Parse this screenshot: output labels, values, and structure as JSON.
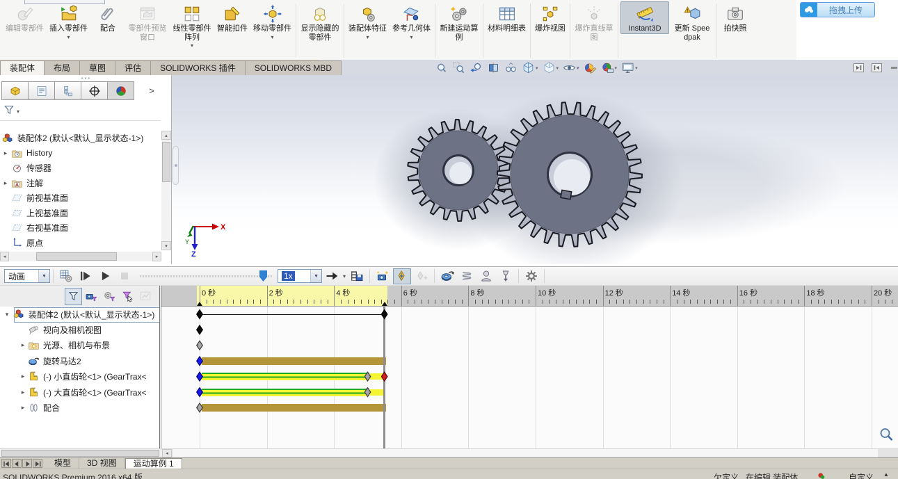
{
  "window": {
    "upload_button_label": "拖拽上传"
  },
  "ribbon": {
    "items": [
      {
        "label": "编辑零部件",
        "icon": "edit-component",
        "disabled": true
      },
      {
        "label": "插入零部件",
        "icon": "insert-component",
        "dropdown": true
      },
      {
        "label": "配合",
        "icon": "mate"
      },
      {
        "label": "零部件预览窗口",
        "icon": "component-preview",
        "disabled": true
      },
      {
        "label": "线性零部件阵列",
        "icon": "linear-pattern",
        "dropdown": true
      },
      {
        "label": "智能扣件",
        "icon": "smart-fasteners"
      },
      {
        "label": "移动零部件",
        "icon": "move-component",
        "dropdown": true
      },
      {
        "label": "显示隐藏的零部件",
        "icon": "show-hidden"
      },
      {
        "label": "装配体特征",
        "icon": "assembly-features",
        "dropdown": true
      },
      {
        "label": "参考几何体",
        "icon": "reference-geometry",
        "dropdown": true
      },
      {
        "label": "新建运动算例",
        "icon": "new-motion-study"
      },
      {
        "label": "材料明细表",
        "icon": "bom"
      },
      {
        "label": "爆炸视图",
        "icon": "exploded-view"
      },
      {
        "label": "爆炸直线草图",
        "icon": "explode-line-sketch",
        "disabled": true
      },
      {
        "label": "Instant3D",
        "icon": "instant3d",
        "active": true
      },
      {
        "label": "更新 Speedpak",
        "icon": "update-speedpak"
      },
      {
        "label": "拍快照",
        "icon": "take-snapshot"
      }
    ]
  },
  "command_tabs": {
    "items": [
      "装配体",
      "布局",
      "草图",
      "评估",
      "SOLIDWORKS 插件",
      "SOLIDWORKS MBD"
    ],
    "active_index": 0
  },
  "headsup_toolbar": {
    "icons": [
      {
        "name": "zoom-to-fit"
      },
      {
        "name": "zoom-to-area"
      },
      {
        "name": "previous-view"
      },
      {
        "name": "section-view"
      },
      {
        "name": "dynamic-annotation-views"
      },
      {
        "name": "view-orientation",
        "dropdown": true
      },
      {
        "name": "display-style",
        "dropdown": true
      },
      {
        "name": "hide-show-items",
        "dropdown": true
      },
      {
        "name": "edit-appearance"
      },
      {
        "name": "apply-scene",
        "dropdown": true
      },
      {
        "name": "view-settings",
        "dropdown": true
      }
    ]
  },
  "feature_panel": {
    "tabs": [
      "featuremanager-design-tree",
      "propertymanager",
      "configurationmanager",
      "dimxpertmanager",
      "displaymanager"
    ],
    "filter_icon": "filter-funnel",
    "root_label": "装配体2 (默认<默认_显示状态-1>)",
    "items": [
      {
        "label": "History",
        "icon": "history",
        "expandable": true
      },
      {
        "label": "传感器",
        "icon": "sensors"
      },
      {
        "label": "注解",
        "icon": "annotations",
        "expandable": true
      },
      {
        "label": "前视基准面",
        "icon": "plane"
      },
      {
        "label": "上视基准面",
        "icon": "plane"
      },
      {
        "label": "右视基准面",
        "icon": "plane"
      },
      {
        "label": "原点",
        "icon": "origin"
      }
    ]
  },
  "viewport": {
    "triad": {
      "x_label": "X",
      "y_label": "Y",
      "z_label": "Z"
    }
  },
  "motion_manager": {
    "study_type_value": "动画",
    "speed_value": "1x",
    "toolbar_icons": [
      "calculate",
      "play-from-start",
      "play",
      "stop",
      "playback-mode",
      "save-animation",
      "animation-wizard",
      "auto-key",
      "add-key",
      "motor",
      "spring",
      "contact",
      "gravity",
      "motion-study-properties"
    ],
    "filters": [
      "filter-all",
      "filter-animated",
      "filter-driving",
      "filter-selected",
      "filter-results"
    ],
    "ruler": {
      "major_labels": [
        "0 秒",
        "2 秒",
        "4 秒",
        "6 秒",
        "8 秒",
        "10 秒",
        "12 秒",
        "14 秒",
        "16 秒",
        "18 秒",
        "20 秒"
      ],
      "seconds_per_major": 2,
      "active_start": 0,
      "active_end": 5.5,
      "playhead": 5.5
    },
    "rows": [
      {
        "label": "装配体2 (默认<默认_显示状态-1>)",
        "icon": "assembly-root",
        "expanded": true,
        "selected": true,
        "keys": [
          {
            "t": 0,
            "color": "black"
          },
          {
            "t": 5.5,
            "color": "black"
          }
        ],
        "line": [
          0,
          5.5
        ],
        "bars": []
      },
      {
        "label": "视向及相机视图",
        "icon": "camera-views",
        "keys": [
          {
            "t": 0,
            "color": "black"
          }
        ],
        "bars": []
      },
      {
        "label": "光源、相机与布景",
        "icon": "lights-folder",
        "expandable": true,
        "keys": [
          {
            "t": 0,
            "color": "gray"
          }
        ],
        "bars": []
      },
      {
        "label": "旋转马达2",
        "icon": "motor-item",
        "keys": [
          {
            "t": 0,
            "color": "blue"
          }
        ],
        "bars": [
          {
            "style": "change",
            "from": 0,
            "to": 5.5
          }
        ]
      },
      {
        "label": "(-) 小直齿轮<1> (GearTrax<",
        "icon": "part",
        "expandable": true,
        "keys": [
          {
            "t": 0,
            "color": "blue"
          },
          {
            "t": 5,
            "color": "gray"
          },
          {
            "t": 5.5,
            "color": "red"
          }
        ],
        "bars": [
          {
            "style": "driven",
            "from": 0,
            "to": 5
          },
          {
            "style": "plain-yellow",
            "from": 5,
            "to": 5.5
          }
        ]
      },
      {
        "label": "(-) 大直齿轮<1> (GearTrax<",
        "icon": "part",
        "expandable": true,
        "keys": [
          {
            "t": 0,
            "color": "blue"
          },
          {
            "t": 5,
            "color": "gray"
          }
        ],
        "bars": [
          {
            "style": "driven",
            "from": 0,
            "to": 5
          },
          {
            "style": "plain-yellow",
            "from": 5,
            "to": 5.45
          }
        ]
      },
      {
        "label": "配合",
        "icon": "mates",
        "expandable": true,
        "keys": [
          {
            "t": 0,
            "color": "gray"
          }
        ],
        "bars": [
          {
            "style": "change",
            "from": 0,
            "to": 5.5
          }
        ]
      }
    ]
  },
  "doc_tabs": {
    "items": [
      "模型",
      "3D 视图",
      "运动算例 1"
    ],
    "active_index": 2,
    "nav_icons": [
      "nav-first",
      "nav-prev",
      "nav-next",
      "nav-last"
    ]
  },
  "status_bar": {
    "app_version": "SOLIDWORKS Premium 2016 x64 版",
    "definition_state": "欠定义",
    "editing_state": "在编辑 装配体",
    "custom_label": "自定义"
  },
  "colors": {
    "key_blue": "#1a1af0",
    "key_red": "#d02020",
    "key_gray": "#a6a6a6",
    "key_black": "#0c0c0c",
    "bar_change": "#b5953a",
    "bar_yellow": "#f4f432",
    "bar_green": "#22aa22",
    "ruler_active": "#f8f8a8",
    "upload_blue": "#2e9ae4"
  }
}
